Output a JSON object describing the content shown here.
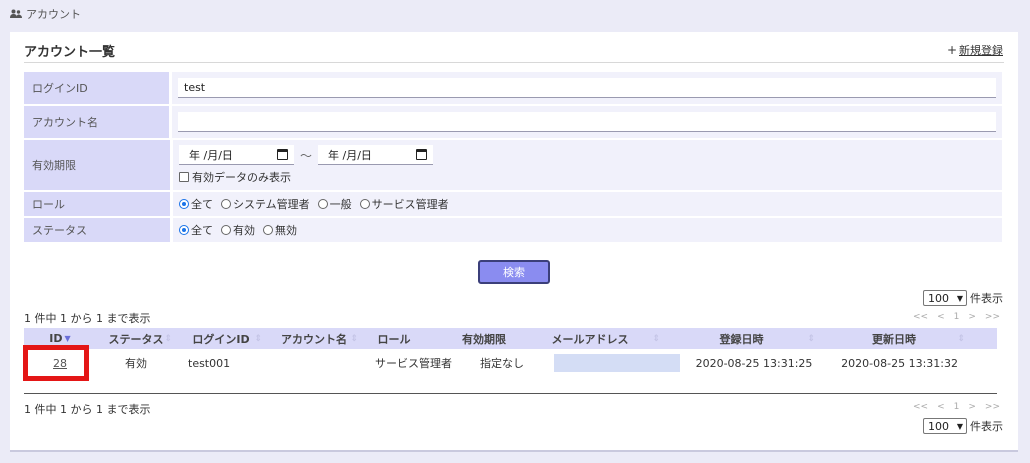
{
  "topbar": {
    "icon": "users-icon",
    "label": "アカウント"
  },
  "card": {
    "title": "アカウント一覧",
    "new_plus": "+",
    "new_label": "新規登録"
  },
  "form": {
    "login_id": {
      "label": "ログインID",
      "value": "test"
    },
    "account_name": {
      "label": "アカウント名",
      "value": ""
    },
    "validity": {
      "label": "有効期限",
      "from_placeholder": "年 /月/日",
      "to_placeholder": "年 /月/日",
      "separator": "〜",
      "only_valid_label": "有効データのみ表示",
      "only_valid_checked": false
    },
    "role": {
      "label": "ロール",
      "options": [
        "全て",
        "システム管理者",
        "一般",
        "サービス管理者"
      ],
      "selected": "全て"
    },
    "status": {
      "label": "ステータス",
      "options": [
        "全て",
        "有効",
        "無効"
      ],
      "selected": "全て"
    }
  },
  "search_button": "検索",
  "pagination": {
    "per_page_value": "100",
    "per_page_suffix": "件表示",
    "summary": "1 件中 1 から 1 まで表示",
    "first": "<<",
    "prev": "<",
    "page": "1",
    "next": ">",
    "last": ">>"
  },
  "table": {
    "headers": [
      "ID",
      "ステータス",
      "ログインID",
      "アカウント名",
      "ロール",
      "有効期限",
      "メールアドレス",
      "登録日時",
      "更新日時"
    ],
    "sorted_column": "ID",
    "rows": [
      {
        "id": "28",
        "status": "有効",
        "login_id": "test001",
        "account_name": "",
        "role": "サービス管理者",
        "validity": "指定なし",
        "email": "",
        "created": "2020-08-25 13:31:25",
        "updated": "2020-08-25 13:31:32"
      }
    ]
  },
  "colors": {
    "accent": "#8a8cf0",
    "label_bg": "#d9d9f8",
    "highlight": "#e41616"
  }
}
